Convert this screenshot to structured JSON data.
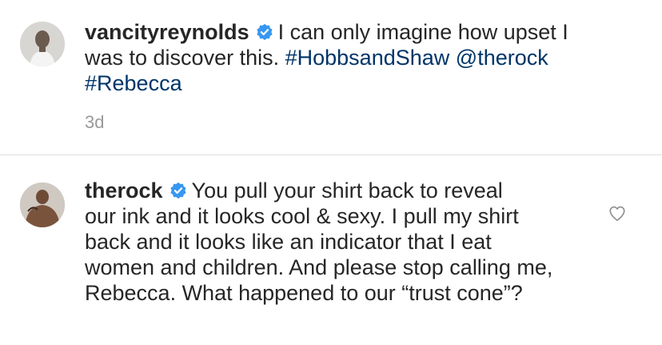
{
  "comments": [
    {
      "username": "vancityreynolds",
      "text": "I can only imagine how upset I was to discover this.",
      "hashtag1": "#HobbsandShaw",
      "mention": "@therock",
      "hashtag2": "#Rebecca",
      "time": "3d",
      "avatar_icon": "avatar-vancityreynolds"
    },
    {
      "username": "therock",
      "text_line1": "You pull your shirt back to reveal",
      "text_rest": "our ink and it looks cool & sexy. I pull my shirt back and it looks like an indicator that I eat women and children. And please stop calling me, Rebecca. What happened to our “trust cone”?",
      "avatar_icon": "avatar-therock"
    }
  ],
  "icons": {
    "verified": "verified-badge-icon",
    "like": "heart-outline-icon"
  },
  "colors": {
    "verified_badge": "#3897f0",
    "link": "#003569",
    "timestamp": "#999999",
    "divider": "#e0e0e0"
  }
}
